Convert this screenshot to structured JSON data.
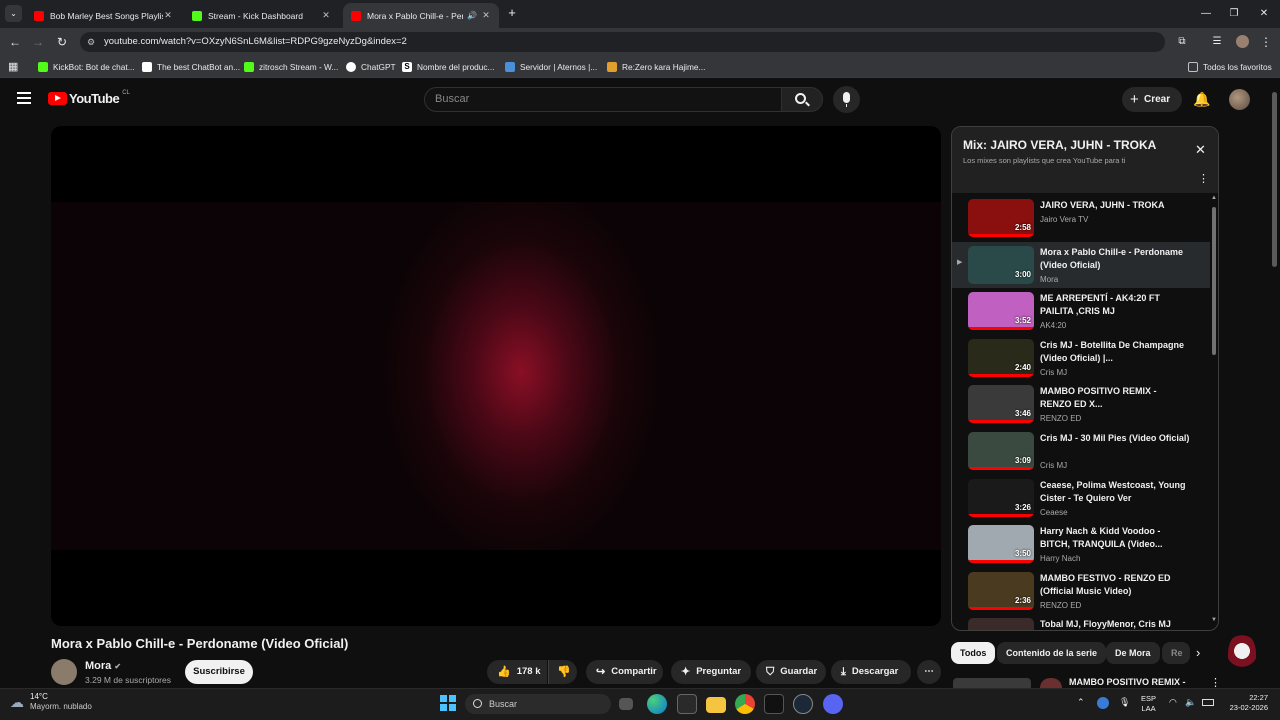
{
  "browser": {
    "tabs": [
      {
        "title": "Bob Marley Best Songs Playlist",
        "favicon_color": "#ff0000"
      },
      {
        "title": "Stream - Kick Dashboard",
        "favicon_color": "#53fc18"
      },
      {
        "title": "Mora x Pablo Chill-e - Perd",
        "favicon_color": "#ff0000",
        "active": true
      }
    ],
    "url": "youtube.com/watch?v=OXzyN6SnL6M&list=RDPG9gzeNyzDg&index=2",
    "bookmarks": [
      {
        "label": "KickBot: Bot de chat...",
        "color": "#53fc18"
      },
      {
        "label": "The best ChatBot an...",
        "color": "#ffffff"
      },
      {
        "label": "zitrosch Stream - W...",
        "color": "#53fc18"
      },
      {
        "label": "ChatGPT",
        "color": "#ffffff"
      },
      {
        "label": "Nombre del produc...",
        "color": "#ffffff"
      },
      {
        "label": "Servidor | Aternos |...",
        "color": "#4a90d9"
      },
      {
        "label": "Re:Zero kara Hajime...",
        "color": "#e0a030"
      }
    ],
    "all_bookmarks": "Todos los favoritos"
  },
  "youtube": {
    "logo_text": "YouTube",
    "region": "CL",
    "search_placeholder": "Buscar",
    "create_label": "Crear"
  },
  "video": {
    "title": "Mora x Pablo Chill-e - Perdoname (Video Oficial)",
    "channel": "Mora",
    "subscribers": "3.29 M de suscriptores",
    "subscribe_label": "Suscribirse",
    "likes": "178 k",
    "share_label": "Compartir",
    "ask_label": "Preguntar",
    "save_label": "Guardar",
    "download_label": "Descargar"
  },
  "playlist": {
    "title": "Mix: JAIRO VERA, JUHN - TROKA",
    "subtitle": "Los mixes son playlists que crea YouTube para ti",
    "items": [
      {
        "title": "JAIRO VERA, JUHN - TROKA",
        "channel": "Jairo Vera TV",
        "duration": "2:58",
        "thumb": "#8a1010",
        "progress": 1.0
      },
      {
        "title": "Mora x Pablo Chill-e - Perdoname (Video Oficial)",
        "channel": "Mora",
        "duration": "3:00",
        "thumb": "#2a4a4a",
        "progress": 0.0,
        "current": true
      },
      {
        "title": "ME ARREPENTÍ - AK4:20 FT PAILITA ,CRIS MJ",
        "channel": "AK4:20",
        "duration": "3:52",
        "thumb": "#c060c0",
        "progress": 1.0
      },
      {
        "title": "Cris MJ - Botellita De Champagne (Video Oficial) |...",
        "channel": "Cris MJ",
        "duration": "2:40",
        "thumb": "#2a2a1a",
        "progress": 1.0
      },
      {
        "title": "MAMBO POSITIVO REMIX - RENZO ED X...",
        "channel": "RENZO ED",
        "duration": "3:46",
        "thumb": "#3a3a3a",
        "progress": 1.0
      },
      {
        "title": "Cris MJ - 30 Mil Pies (Video Oficial)",
        "channel": "Cris MJ",
        "duration": "3:09",
        "thumb": "#3a4a40",
        "progress": 1.0
      },
      {
        "title": "Ceaese, Polima Westcoast, Young Cister - Te Quiero Ver",
        "channel": "Ceaese",
        "duration": "3:26",
        "thumb": "#1a1a1a",
        "progress": 1.0
      },
      {
        "title": "Harry Nach & Kidd Voodoo - BITCH, TRANQUILA (Video...",
        "channel": "Harry Nach",
        "duration": "3:50",
        "thumb": "#a0a8b0",
        "progress": 1.0
      },
      {
        "title": "MAMBO FESTIVO - RENZO ED (Official Music Video)",
        "channel": "RENZO ED",
        "duration": "2:36",
        "thumb": "#4a3a20",
        "progress": 1.0
      },
      {
        "title": "Tobal MJ, FloyyMenor, Cris MJ",
        "channel": "",
        "duration": "",
        "thumb": "#3a2a2a",
        "progress": 0.0
      }
    ]
  },
  "chips": [
    "Todos",
    "Contenido de la serie",
    "De Mora",
    "Re"
  ],
  "recommendation_peek": "MAMBO POSITIVO REMIX -",
  "taskbar": {
    "weather_temp": "14°C",
    "weather_desc": "Mayorm. nublado",
    "search_label": "Buscar",
    "lang": "ESP",
    "lang2": "LAA",
    "time": "22:27",
    "date": "23-02-2026"
  }
}
